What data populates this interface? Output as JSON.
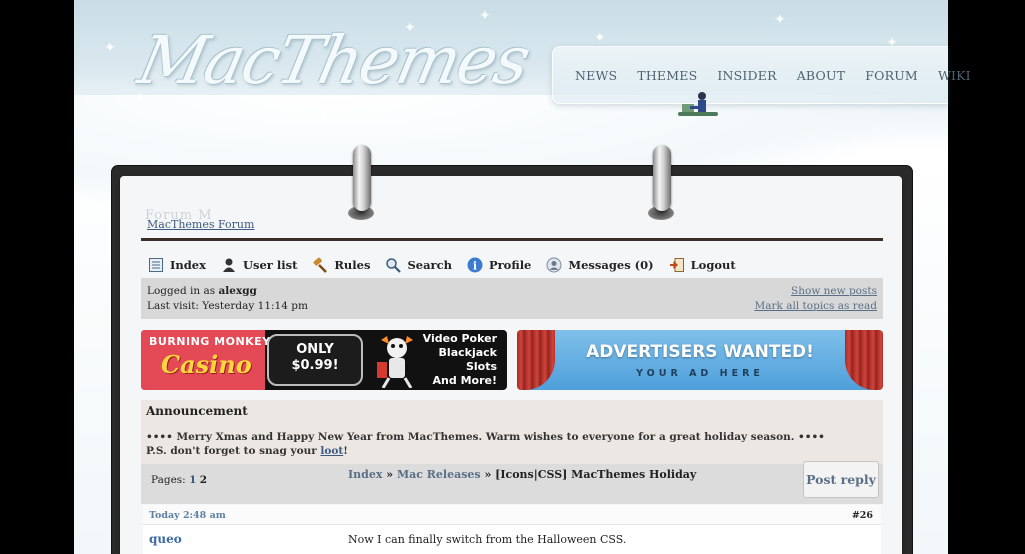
{
  "site": {
    "logo_text": "MacThemes"
  },
  "nav": {
    "items": [
      "NEWS",
      "THEMES",
      "INSIDER",
      "ABOUT",
      "FORUM",
      "WIKI"
    ]
  },
  "forum": {
    "breadcrumb_top": "MacThemes Forum",
    "ghost_title": "Forum M"
  },
  "toolbar": {
    "items": [
      {
        "label": "Index",
        "icon": "index-icon"
      },
      {
        "label": "User list",
        "icon": "user-icon"
      },
      {
        "label": "Rules",
        "icon": "gavel-icon"
      },
      {
        "label": "Search",
        "icon": "search-icon"
      },
      {
        "label": "Profile",
        "icon": "info-icon"
      },
      {
        "label": "Messages (0)",
        "icon": "messages-icon"
      },
      {
        "label": "Logout",
        "icon": "logout-icon"
      }
    ]
  },
  "status": {
    "logged_in_prefix": "Logged in as",
    "username": "alexgg",
    "last_visit": "Last visit: Yesterday 11:14 pm",
    "show_new_posts": "Show new posts",
    "mark_all_read": "Mark all topics as read"
  },
  "ads": {
    "casino": {
      "brand_line1": "BURNING MONKEY",
      "brand_line2": "Casino",
      "price_line1": "ONLY",
      "price_line2": "$0.99!",
      "games": [
        "Video Poker",
        "Blackjack",
        "Slots",
        "And More!"
      ]
    },
    "advertisers": {
      "headline": "ADVERTISERS WANTED!",
      "subline": "YOUR AD HERE"
    }
  },
  "announcement": {
    "title": "Announcement",
    "line1": "•••• Merry Xmas and Happy New Year from MacThemes. Warm wishes to everyone for a great holiday season. ••••",
    "line2_prefix": "P.S. don't forget to snag your",
    "line2_link": "loot",
    "line2_suffix": "!"
  },
  "topic": {
    "pages_label": "Pages:",
    "page_1": "1",
    "page_2": "2",
    "crumb_index": "Index",
    "crumb_sep": " » ",
    "crumb_category": "Mac Releases",
    "crumb_topic": "[Icons|CSS] MacThemes Holiday",
    "post_reply": "Post reply"
  },
  "post": {
    "time": "Today 2:48 am",
    "number": "#26",
    "author": "queo",
    "text": "Now I can finally switch from the Halloween CSS."
  },
  "colors": {
    "accent_link": "#3d5a80",
    "binder": "#2a2a2a",
    "casino_red": "#e34a55",
    "adv_blue": "#4f9fdb"
  }
}
